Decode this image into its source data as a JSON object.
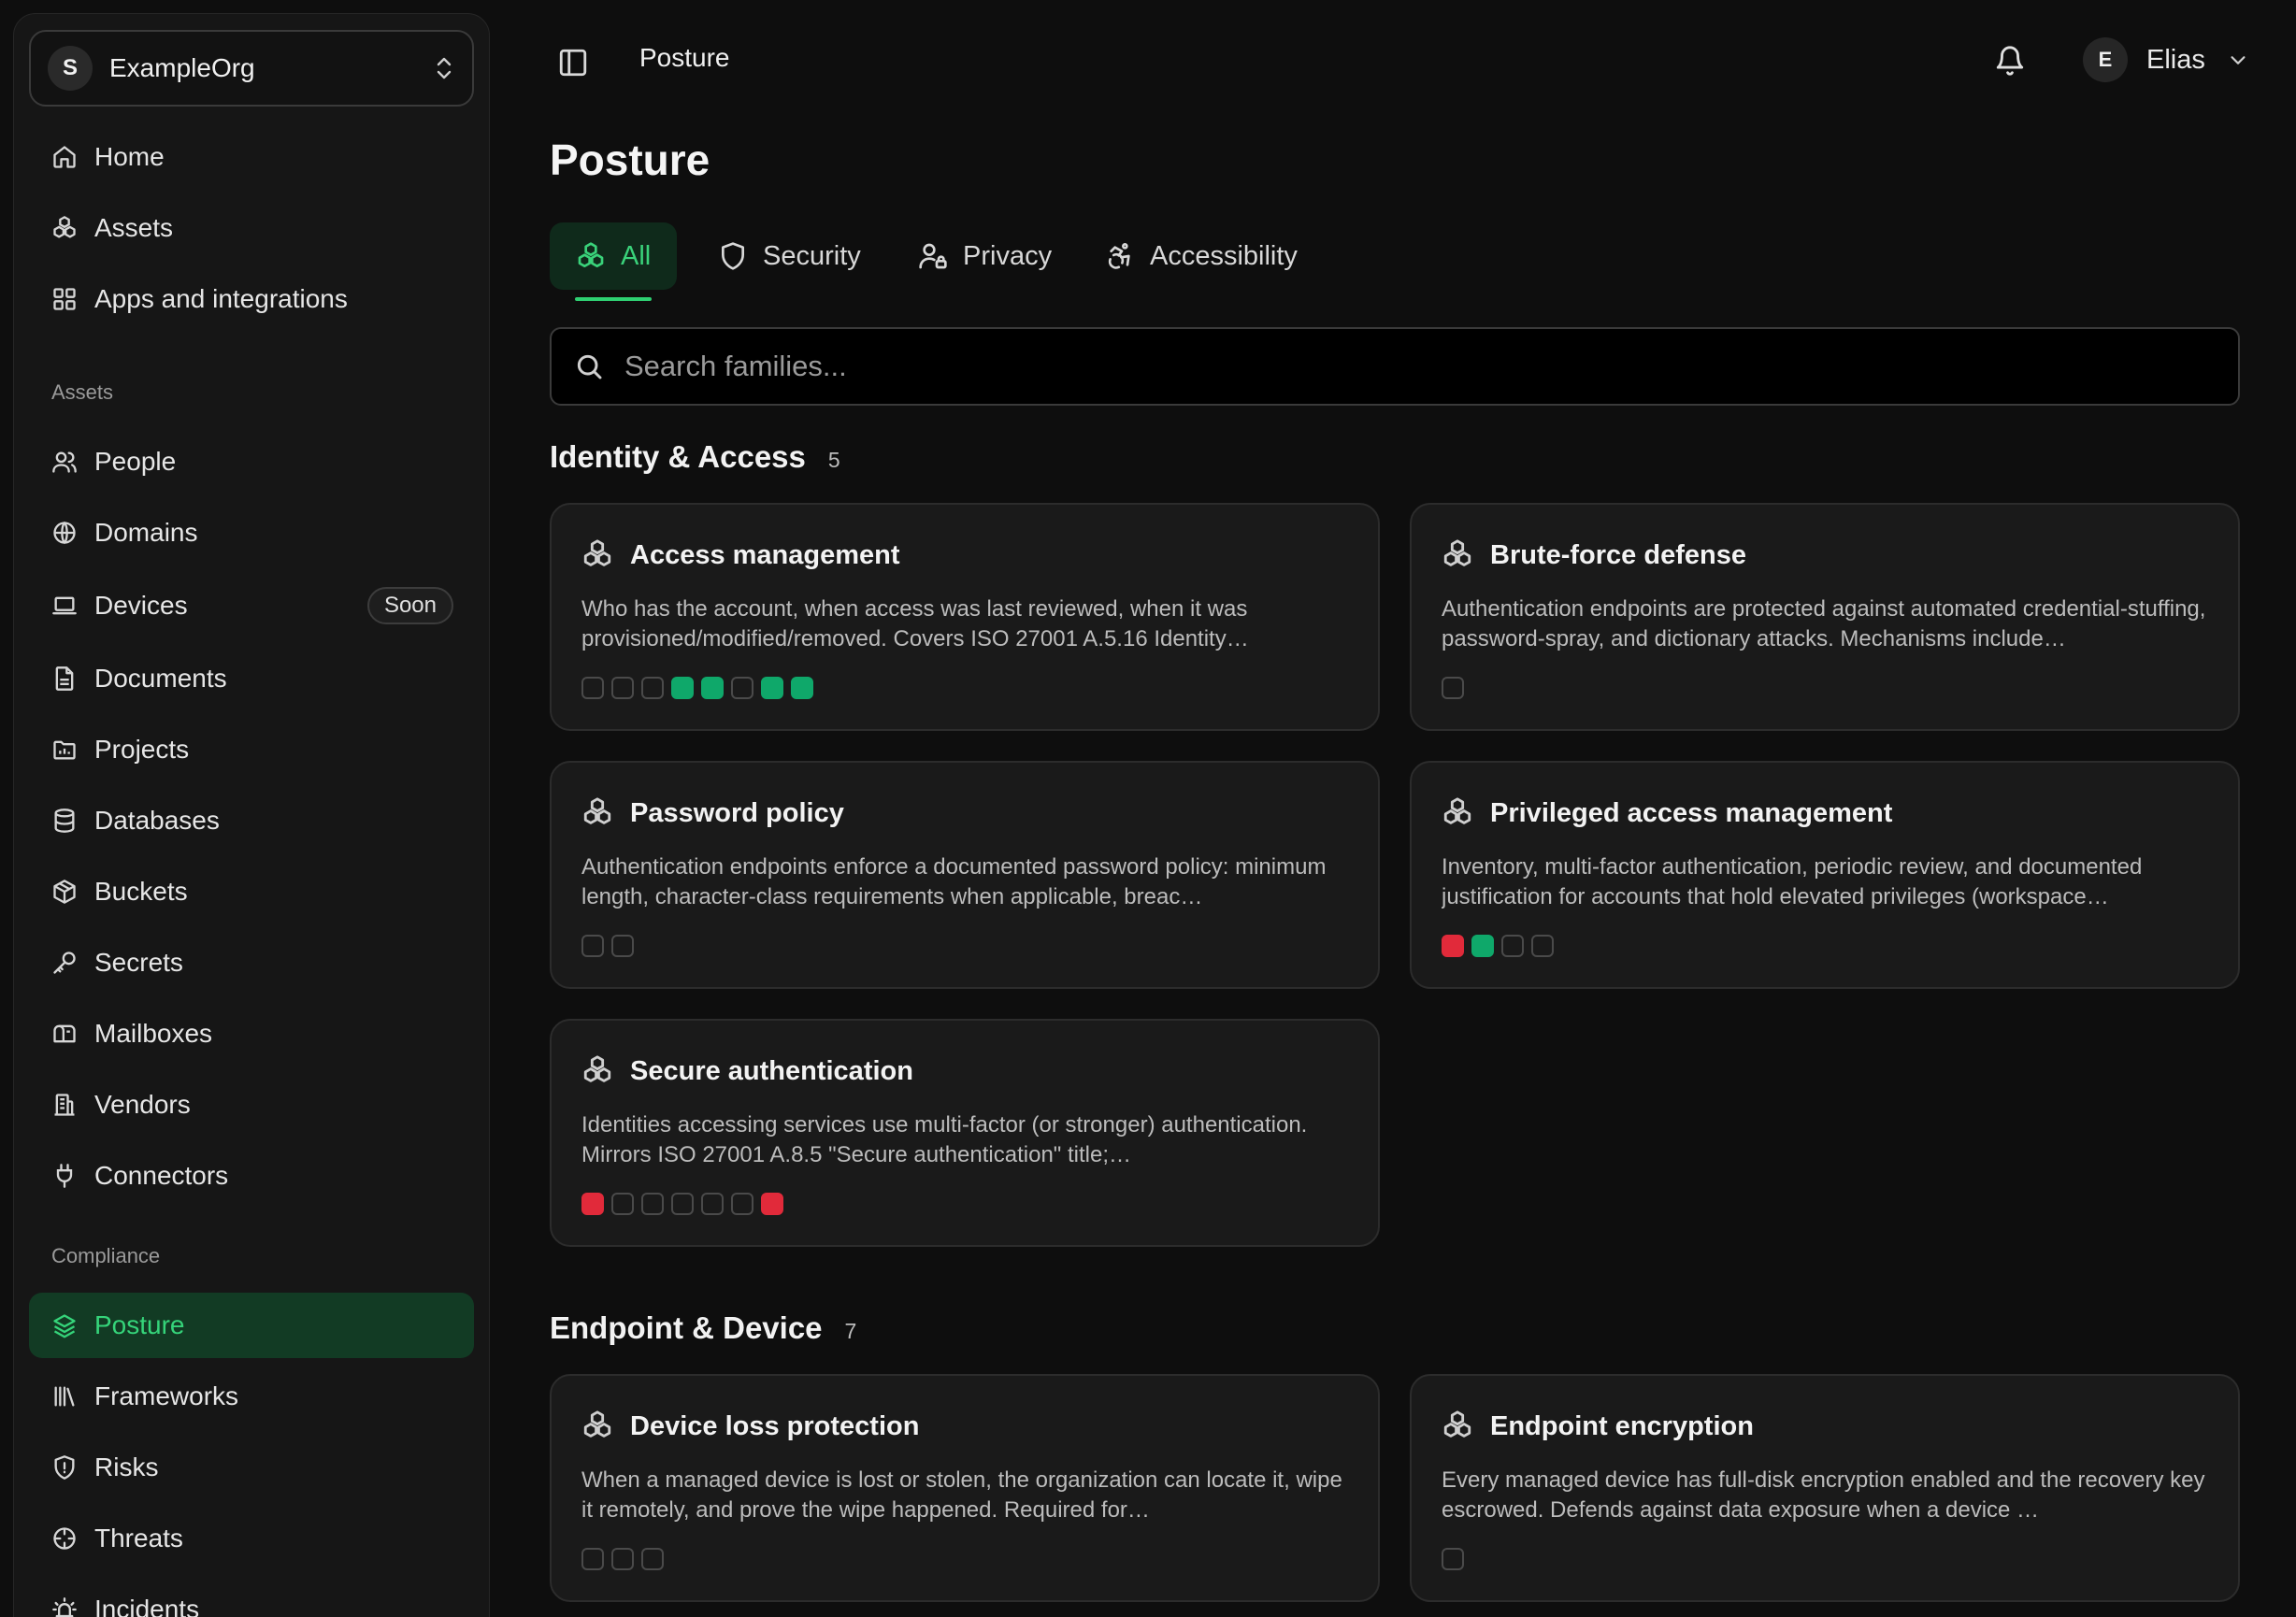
{
  "org": {
    "initial": "S",
    "name": "ExampleOrg"
  },
  "sidebar": {
    "main": [
      {
        "label": "Home",
        "icon": "home-icon"
      },
      {
        "label": "Assets",
        "icon": "boxes-icon"
      },
      {
        "label": "Apps and integrations",
        "icon": "grid-icon"
      }
    ],
    "assets_group": "Assets",
    "assets": [
      {
        "label": "People",
        "icon": "users-icon"
      },
      {
        "label": "Domains",
        "icon": "globe-icon"
      },
      {
        "label": "Devices",
        "icon": "laptop-icon",
        "badge": "Soon"
      },
      {
        "label": "Documents",
        "icon": "file-icon"
      },
      {
        "label": "Projects",
        "icon": "folder-icon"
      },
      {
        "label": "Databases",
        "icon": "database-icon"
      },
      {
        "label": "Buckets",
        "icon": "package-icon"
      },
      {
        "label": "Secrets",
        "icon": "key-icon"
      },
      {
        "label": "Mailboxes",
        "icon": "mailbox-icon"
      },
      {
        "label": "Vendors",
        "icon": "building-icon"
      },
      {
        "label": "Connectors",
        "icon": "plug-icon"
      }
    ],
    "compliance_group": "Compliance",
    "compliance": [
      {
        "label": "Posture",
        "icon": "layers-icon",
        "active": true
      },
      {
        "label": "Frameworks",
        "icon": "library-icon"
      },
      {
        "label": "Risks",
        "icon": "shield-alert-icon"
      },
      {
        "label": "Threats",
        "icon": "target-icon"
      },
      {
        "label": "Incidents",
        "icon": "siren-icon"
      }
    ]
  },
  "topbar": {
    "title": "Posture",
    "user_initial": "E",
    "user_name": "Elias"
  },
  "page": {
    "title": "Posture"
  },
  "tabs": [
    {
      "label": "All",
      "icon": "boxes-icon",
      "active": true
    },
    {
      "label": "Security",
      "icon": "shield-icon"
    },
    {
      "label": "Privacy",
      "icon": "user-lock-icon"
    },
    {
      "label": "Accessibility",
      "icon": "accessibility-icon"
    }
  ],
  "search": {
    "placeholder": "Search families..."
  },
  "sections": [
    {
      "name": "Identity & Access",
      "count": "5",
      "cards": [
        {
          "title": "Access management",
          "desc": "Who has the account, when access was last reviewed, when it was provisioned/modified/removed. Covers ISO 27001 A.5.16 Identity…",
          "status": [
            "empty",
            "empty",
            "empty",
            "green",
            "green",
            "empty",
            "green",
            "green"
          ]
        },
        {
          "title": "Brute-force defense",
          "desc": "Authentication endpoints are protected against automated credential-stuffing, password-spray, and dictionary attacks. Mechanisms include…",
          "status": [
            "empty"
          ]
        },
        {
          "title": "Password policy",
          "desc": "Authentication endpoints enforce a documented password policy: minimum length, character-class requirements when applicable, breac…",
          "status": [
            "empty",
            "empty"
          ]
        },
        {
          "title": "Privileged access management",
          "desc": "Inventory, multi-factor authentication, periodic review, and documented justification for accounts that hold elevated privileges (workspace…",
          "status": [
            "red",
            "green",
            "empty",
            "empty"
          ]
        },
        {
          "title": "Secure authentication",
          "desc": "Identities accessing services use multi-factor (or stronger) authentication. Mirrors ISO 27001 A.8.5 \"Secure authentication\" title;…",
          "status": [
            "red",
            "empty",
            "empty",
            "empty",
            "empty",
            "empty",
            "red"
          ]
        }
      ]
    },
    {
      "name": "Endpoint & Device",
      "count": "7",
      "cards": [
        {
          "title": "Device loss protection",
          "desc": "When a managed device is lost or stolen, the organization can locate it, wipe it remotely, and prove the wipe happened. Required for…",
          "status": [
            "empty",
            "empty",
            "empty"
          ]
        },
        {
          "title": "Endpoint encryption",
          "desc": "Every managed device has full-disk encryption enabled and the recovery key escrowed. Defends against data exposure when a device …",
          "status": [
            "empty"
          ]
        }
      ]
    }
  ],
  "colors": {
    "accent": "#35d47a",
    "active_bg": "#123b24",
    "status_green": "#0fa86a",
    "status_red": "#e12a3a"
  }
}
